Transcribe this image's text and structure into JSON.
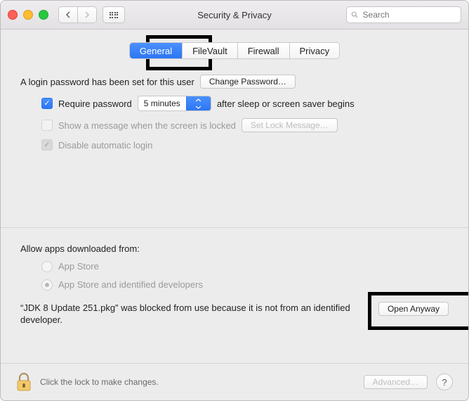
{
  "window": {
    "title": "Security & Privacy"
  },
  "search": {
    "placeholder": "Search"
  },
  "tabs": {
    "general": "General",
    "filevault": "FileVault",
    "firewall": "Firewall",
    "privacy": "Privacy",
    "active": "general"
  },
  "login": {
    "password_set_text": "A login password has been set for this user",
    "change_password_btn": "Change Password…",
    "require_password_label": "Require password",
    "require_password_checked": true,
    "delay_value": "5 minutes",
    "after_sleep_text": "after sleep or screen saver begins",
    "show_message_label": "Show a message when the screen is locked",
    "show_message_checked": false,
    "set_lock_message_btn": "Set Lock Message…",
    "disable_auto_login_label": "Disable automatic login",
    "disable_auto_login_checked": true
  },
  "download": {
    "heading": "Allow apps downloaded from:",
    "opt_appstore": "App Store",
    "opt_identified": "App Store and identified developers",
    "selected": "identified",
    "blocked_msg": "“JDK 8 Update 251.pkg” was blocked from use because it is not from an identified developer.",
    "open_anyway_btn": "Open Anyway"
  },
  "footer": {
    "lock_msg": "Click the lock to make changes.",
    "advanced_btn": "Advanced…"
  }
}
